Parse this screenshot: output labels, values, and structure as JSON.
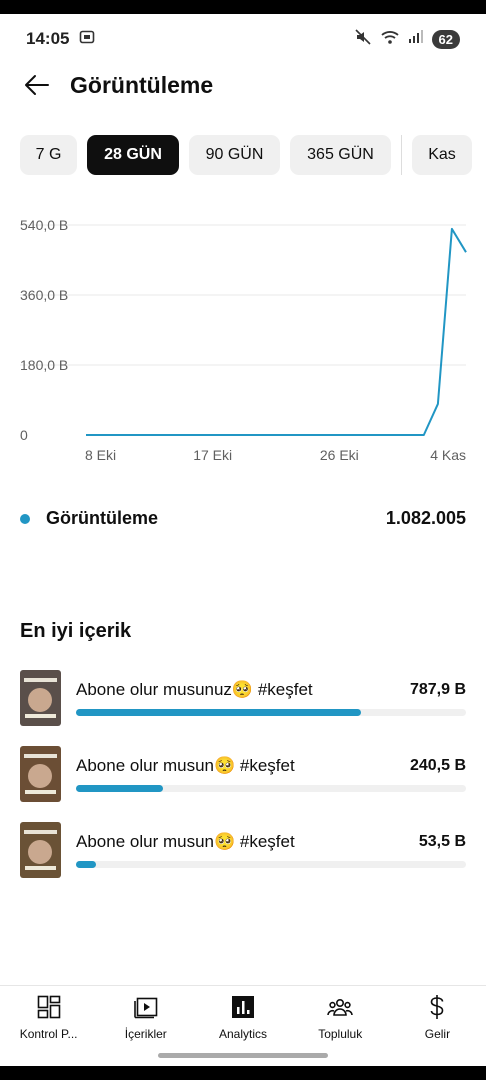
{
  "status_bar": {
    "time": "14:05",
    "battery": "62"
  },
  "header": {
    "title": "Görüntüleme"
  },
  "period_chips": [
    {
      "label": "7 G",
      "active": false
    },
    {
      "label": "28 GÜN",
      "active": true
    },
    {
      "label": "90 GÜN",
      "active": false
    },
    {
      "label": "365 GÜN",
      "active": false
    },
    {
      "label": "Kas",
      "active": false
    }
  ],
  "chart_data": {
    "type": "line",
    "x_tick_labels": [
      "8 Eki",
      "17 Eki",
      "26 Eki",
      "4 Kas"
    ],
    "y_tick_labels": [
      "540,0 B",
      "360,0 B",
      "180,0 B",
      "0"
    ],
    "ylim": [
      0,
      540000
    ],
    "grid": true,
    "series": [
      {
        "color": "#2196c4",
        "x": [
          "8 Eki",
          "9 Eki",
          "10 Eki",
          "11 Eki",
          "12 Eki",
          "13 Eki",
          "14 Eki",
          "15 Eki",
          "16 Eki",
          "17 Eki",
          "18 Eki",
          "19 Eki",
          "20 Eki",
          "21 Eki",
          "22 Eki",
          "23 Eki",
          "24 Eki",
          "25 Eki",
          "26 Eki",
          "27 Eki",
          "28 Eki",
          "29 Eki",
          "30 Eki",
          "31 Eki",
          "1 Kas",
          "2 Kas",
          "3 Kas",
          "4 Kas"
        ],
        "values": [
          0,
          0,
          0,
          0,
          0,
          0,
          0,
          0,
          0,
          0,
          0,
          0,
          0,
          0,
          0,
          0,
          0,
          0,
          0,
          0,
          0,
          0,
          0,
          0,
          0,
          80000,
          530000,
          470000
        ]
      }
    ]
  },
  "metric": {
    "label": "Görüntüleme",
    "value": "1.082.005",
    "color": "#2196c4"
  },
  "top_content": {
    "title": "En iyi içerik",
    "items": [
      {
        "title": "Abone olur musunuz🥺 #keşfet",
        "views": "787,9 B",
        "fraction": 0.73,
        "thumb_bg": "#5a4f4a"
      },
      {
        "title": "Abone olur musun🥺 #keşfet",
        "views": "240,5 B",
        "fraction": 0.223,
        "thumb_bg": "#6b4e35"
      },
      {
        "title": "Abone olur musun🥺 #keşfet",
        "views": "53,5 B",
        "fraction": 0.05,
        "thumb_bg": "#6a5236"
      }
    ]
  },
  "bottom_nav": [
    {
      "label": "Kontrol P...",
      "icon": "dashboard-icon"
    },
    {
      "label": "İçerikler",
      "icon": "content-icon"
    },
    {
      "label": "Analytics",
      "icon": "analytics-icon"
    },
    {
      "label": "Topluluk",
      "icon": "community-icon"
    },
    {
      "label": "Gelir",
      "icon": "dollar-icon"
    }
  ]
}
